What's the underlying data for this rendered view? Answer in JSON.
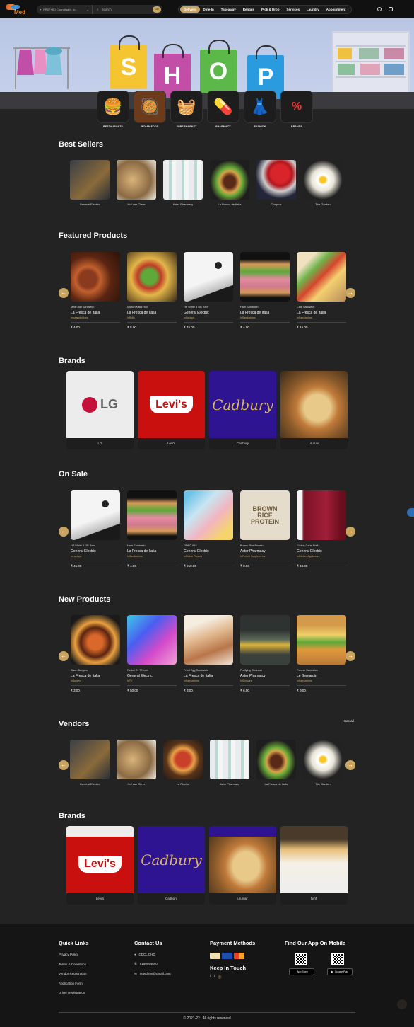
{
  "nav": {
    "brand": "Med",
    "location": "PR07+8Q Chandigarh, In...",
    "search_placeholder": "Search",
    "search_go": "GO",
    "tabs": [
      "Delivery",
      "Dine-In",
      "Takeaway",
      "Rentals",
      "Pick & Drop",
      "Services",
      "Laundry",
      "Appointment"
    ],
    "active_tab": "Delivery"
  },
  "hero": {
    "letters": [
      "S",
      "H",
      "O",
      "P"
    ],
    "colors": {
      "s": "#f4c431",
      "h": "#c24ea8",
      "o": "#5db84a",
      "p": "#2b9be0"
    }
  },
  "categories": [
    {
      "label": "RESTAURANTS",
      "icon": "burger-icon"
    },
    {
      "label": "INDIAN FOOD",
      "icon": "spices-icon"
    },
    {
      "label": "SUPERMARKET",
      "icon": "basket-icon"
    },
    {
      "label": "PHARMACY",
      "icon": "pills-icon"
    },
    {
      "label": "FASHION",
      "icon": "dress-icon"
    },
    {
      "label": "BRANDS",
      "icon": "discount-bag-icon"
    }
  ],
  "best_sellers": {
    "title": "Best Sellers",
    "items": [
      "General Electric",
      "Hof van Cleve",
      "Aster Pharmacy",
      "La Fresca de Italia",
      "Chapros",
      "The Garden"
    ]
  },
  "featured": {
    "title": "Featured Products",
    "items": [
      {
        "name": "Meat Ball Sandwich",
        "vendor": "La Fresca de Italia",
        "category": "Infosandwiches",
        "price": "₹ 4.00"
      },
      {
        "name": "Mutton Kathi Roll",
        "vendor": "La Fresca de Italia",
        "category": "InRolls",
        "price": "₹ 5.00"
      },
      {
        "name": "HP White 8 GB Ram",
        "vendor": "General Electric",
        "category": "InLaptops",
        "price": "₹ 45.00"
      },
      {
        "name": "Ham Sandwich",
        "vendor": "La Fresca de Italia",
        "category": "InSandwiches",
        "price": "₹ 4.00"
      },
      {
        "name": "Club Sandwich",
        "vendor": "La Fresca de Italia",
        "category": "InSandwiches",
        "price": "₹ 15.00"
      }
    ]
  },
  "brands": {
    "title": "Brands",
    "items": [
      "LG",
      "Levi's",
      "Cadbury",
      "ururuur"
    ]
  },
  "on_sale": {
    "title": "On Sale",
    "items": [
      {
        "name": "HP White 8 GB Ram",
        "vendor": "General Electric",
        "category": "InLaptops",
        "price": "₹ 45.00"
      },
      {
        "name": "Ham Sandwich",
        "vendor": "La Fresca de Italia",
        "category": "InSandwiches",
        "price": "₹ 4.00"
      },
      {
        "name": "OPPO A16",
        "vendor": "General Electric",
        "category": "InMobile Phones",
        "price": "₹ 210.00"
      },
      {
        "name": "Brown Rice Protein",
        "vendor": "Aster Pharmacy",
        "category": "InProtein Supplements",
        "price": "₹ 8.00"
      },
      {
        "name": "Godrej 2 star Fridi...",
        "vendor": "General Electric",
        "category": "InKitchen Appliances",
        "price": "₹ 44.00"
      }
    ]
  },
  "new_products": {
    "title": "New Products",
    "items": [
      {
        "name": "Bison Burgers",
        "vendor": "La Fresca de Italia",
        "category": "InBurgers",
        "price": "₹ 3.00"
      },
      {
        "name": "Redmi Tv 70 Inch",
        "vendor": "General Electric",
        "category": "InTV",
        "price": "₹ 50.00"
      },
      {
        "name": "Fried Egg Sandwich",
        "vendor": "La Fresca de Italia",
        "category": "InSandwiches",
        "price": "₹ 3.00"
      },
      {
        "name": "Purifying Cleanser",
        "vendor": "Aster Pharmacy",
        "category": "InSkincare",
        "price": "₹ 6.00"
      },
      {
        "name": "Paneer Sandwich",
        "vendor": "Le Bernardin",
        "category": "InSandwiches",
        "price": "₹ 9.00"
      }
    ]
  },
  "vendors": {
    "title": "Vendors",
    "see_all": "See all",
    "items": [
      "General Electric",
      "Hof van Cleve",
      "La Piscina",
      "Aster Pharmacy",
      "La Fresca de Italia",
      "The Garden"
    ]
  },
  "brands2": {
    "title": "Brands",
    "items": [
      "Levi's",
      "Cadbury",
      "ururuur",
      "hjjhfj"
    ]
  },
  "footer": {
    "quick_links_title": "Quick Links",
    "quick_links": [
      "Privacy Policy",
      "Terms & Conditions",
      "Vendor Registration",
      "Application Form",
      "Driver Registration"
    ],
    "contact_title": "Contact Us",
    "contact": [
      "CDCL CHD",
      "9150054640",
      "newclient@gmail.com"
    ],
    "payment_title": "Payment Methods",
    "keep_in_touch": "Keep In Touch",
    "app_title": "Find Our App On Mobile",
    "app_store": "App Store",
    "google_play": "Google Play",
    "copyright": "© 2021-22 | All rights reserved"
  }
}
